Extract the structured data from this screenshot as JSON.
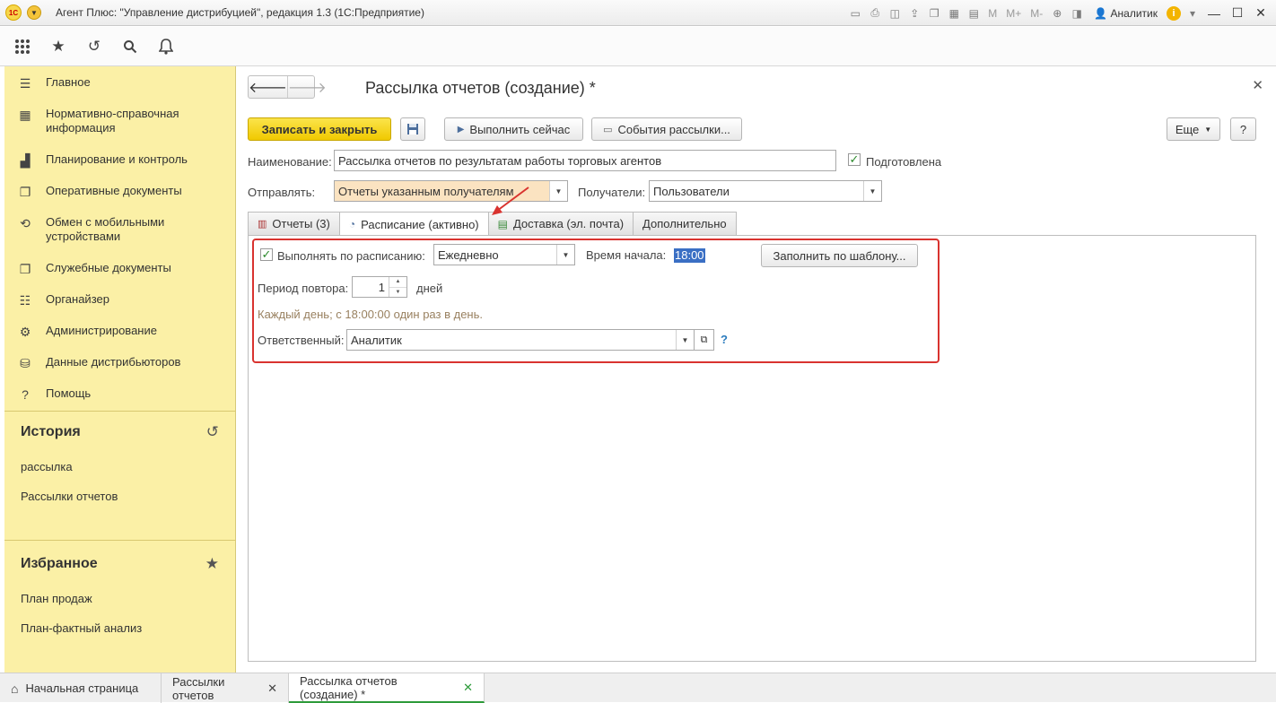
{
  "window": {
    "title": "Агент Плюс: \"Управление дистрибуцией\", редакция 1.3  (1С:Предприятие)",
    "user": "Аналитик",
    "memory_buttons": [
      "M",
      "M+",
      "M-"
    ]
  },
  "sidebar": {
    "items": [
      {
        "label": "Главное",
        "icon": "menu-icon"
      },
      {
        "label": "Нормативно-справочная информация",
        "icon": "grid-icon"
      },
      {
        "label": "Планирование и контроль",
        "icon": "chart-icon"
      },
      {
        "label": "Оперативные документы",
        "icon": "documents-icon"
      },
      {
        "label": "Обмен с мобильными устройствами",
        "icon": "sync-icon"
      },
      {
        "label": "Служебные документы",
        "icon": "documents-icon"
      },
      {
        "label": "Органайзер",
        "icon": "organizer-icon"
      },
      {
        "label": "Администрирование",
        "icon": "gear-icon"
      },
      {
        "label": "Данные дистрибьюторов",
        "icon": "database-icon"
      },
      {
        "label": "Помощь",
        "icon": "help-icon"
      }
    ],
    "history": {
      "title": "История",
      "links": [
        "рассылка",
        "Рассылки отчетов"
      ]
    },
    "favorites": {
      "title": "Избранное",
      "links": [
        "План продаж",
        "План-фактный анализ"
      ]
    }
  },
  "form": {
    "title": "Рассылка отчетов (создание) *",
    "buttons": {
      "save_close": "Записать и закрыть",
      "run_now": "Выполнить сейчас",
      "events": "События рассылки...",
      "more": "Еще",
      "help": "?"
    },
    "name_label": "Наименование:",
    "name_value": "Рассылка отчетов по результатам работы торговых агентов",
    "prepared_label": "Подготовлена",
    "prepared_checked": true,
    "send_label": "Отправлять:",
    "send_value": "Отчеты указанным получателям",
    "recipients_label": "Получатели:",
    "recipients_value": "Пользователи",
    "tabs": [
      {
        "label": "Отчеты (3)",
        "icon": "report-icon"
      },
      {
        "label": "Расписание (активно)",
        "icon": "clock-icon",
        "active": true
      },
      {
        "label": "Доставка (эл. почта)",
        "icon": "delivery-icon"
      },
      {
        "label": "Дополнительно",
        "icon": ""
      }
    ],
    "schedule": {
      "run_label": "Выполнять по расписанию:",
      "run_checked": true,
      "frequency": "Ежедневно",
      "start_time_label": "Время начала:",
      "start_time": "18:00",
      "fill_template": "Заполнить по шаблону...",
      "period_label": "Период повтора:",
      "period_value": "1",
      "period_unit": "дней",
      "summary": "Каждый день; с 18:00:00 один раз в день.",
      "responsible_label": "Ответственный:",
      "responsible_value": "Аналитик",
      "help": "?"
    }
  },
  "bottom_tabs": [
    {
      "label": "Начальная страница",
      "icon": "home-icon",
      "closable": false
    },
    {
      "label": "Рассылки отчетов",
      "closable": true
    },
    {
      "label": "Рассылка отчетов (создание) *",
      "closable": true,
      "active": true
    }
  ],
  "colors": {
    "sidebar_bg": "#fbf0a6",
    "primary_button": "#f5d50f",
    "highlight_border": "#d9332f",
    "active_tab_underline": "#2e9b3a"
  }
}
